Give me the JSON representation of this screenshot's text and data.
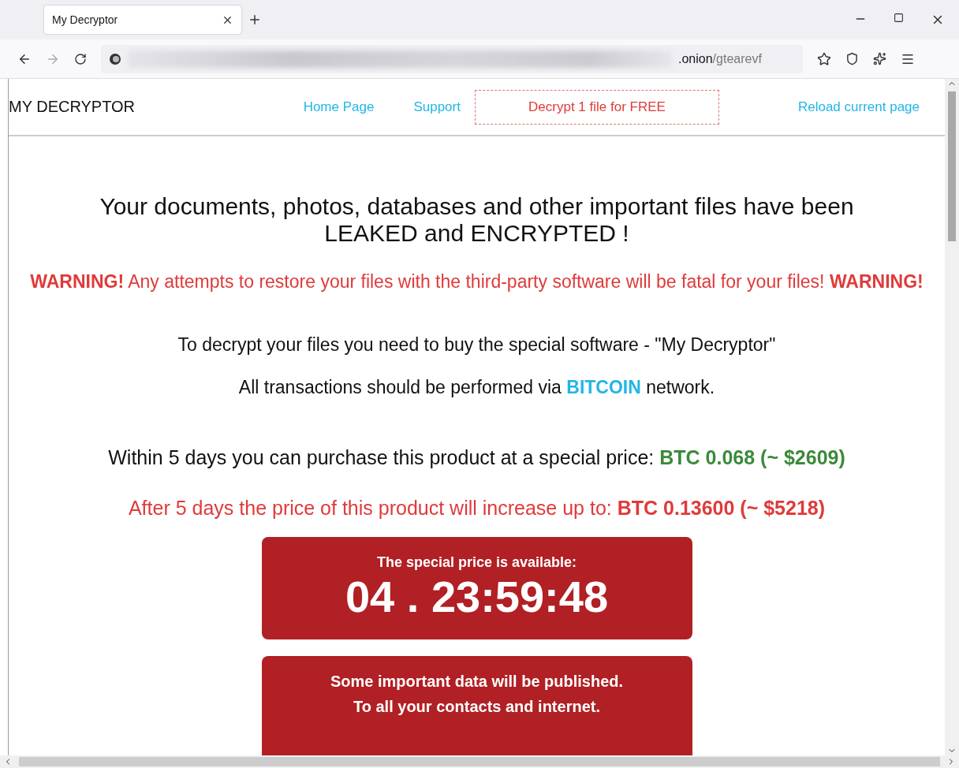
{
  "browser": {
    "tab": {
      "title": "My Decryptor",
      "selected": true
    },
    "address": {
      "host": ".onion",
      "path": "/gtearevf"
    }
  },
  "site": {
    "logo": "MY DECRYPTOR",
    "nav": [
      {
        "label": "Home Page",
        "kind": "link"
      },
      {
        "label": "Support",
        "kind": "link"
      },
      {
        "label": "Decrypt 1 file for FREE",
        "kind": "boxed"
      },
      {
        "label": "Reload current page",
        "kind": "link"
      }
    ]
  },
  "headline": [
    "Your documents, photos, databases and other important files have been",
    "LEAKED and ENCRYPTED !"
  ],
  "lines": [
    {
      "kind": "warning",
      "parts": [
        {
          "text": "WARNING!",
          "strong": true
        },
        {
          "text": " Any attempts to restore your files with the third-party software will be fatal for your files! ",
          "strong": false
        },
        {
          "text": "WARNING!",
          "strong": true
        }
      ]
    },
    {
      "kind": "info",
      "parts": [
        {
          "text": "To decrypt your files you need to buy the special software - \"My Decryptor\"",
          "strong": false
        }
      ]
    },
    {
      "kind": "info",
      "parts": [
        {
          "text": "All transactions should be performed via ",
          "strong": false
        },
        {
          "text": "BITCOIN",
          "strong": true
        },
        {
          "text": " network.",
          "strong": false
        }
      ]
    },
    {
      "kind": "offer",
      "parts": [
        {
          "text": "Within 5 days you can purchase this product at a special price: ",
          "strong": false
        },
        {
          "text": "BTC 0.068 (~ $2609)",
          "strong": true
        }
      ]
    },
    {
      "kind": "increase",
      "parts": [
        {
          "text": "After 5 days the price of this product will increase up to: ",
          "strong": false
        },
        {
          "text": "BTC 0.13600 (~ $5218)",
          "strong": true
        }
      ]
    }
  ],
  "countdown": {
    "label": "The special price is available:",
    "timer": "04 . 23:59:48"
  },
  "publish_notice": [
    "Some important data will be published.",
    "To all your contacts and internet."
  ]
}
